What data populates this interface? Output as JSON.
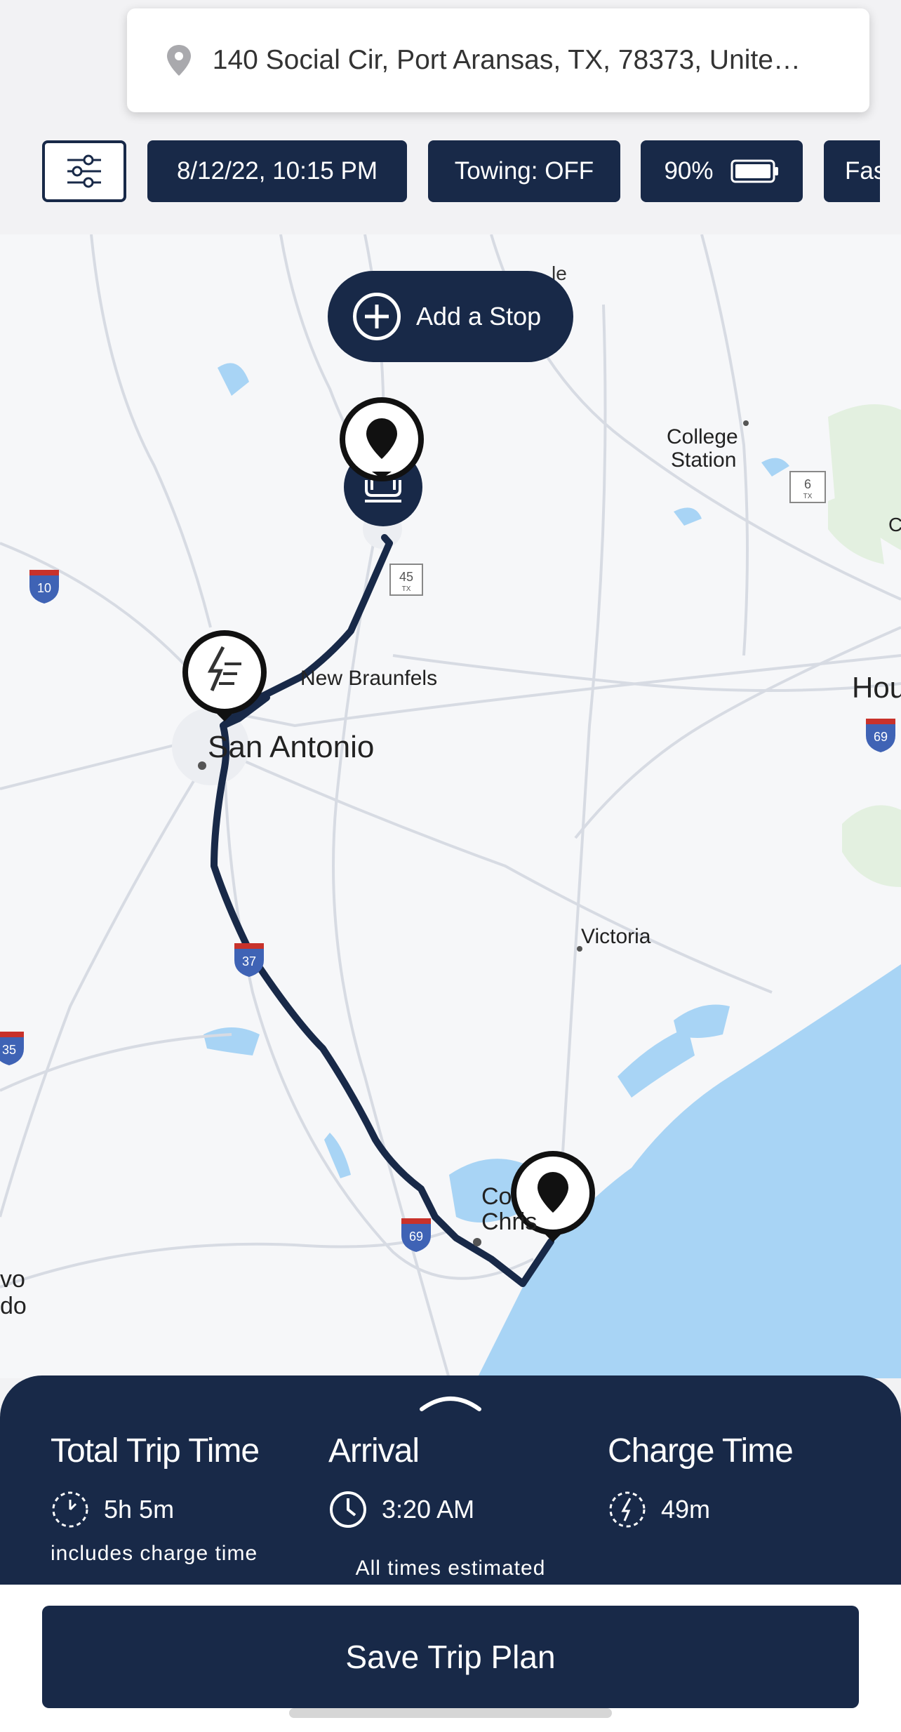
{
  "search": {
    "address": "140 Social Cir, Port Aransas, TX, 78373, Unite…",
    "icon": "location-pin-icon"
  },
  "chips": {
    "filter_icon": "sliders-icon",
    "datetime": "8/12/22, 10:15 PM",
    "towing": "Towing: OFF",
    "battery": "90%",
    "battery_icon": "battery-icon",
    "partial": "Fas"
  },
  "map": {
    "add_stop": "Add a Stop",
    "labels": {
      "college_station_1": "College",
      "college_station_2": "Station",
      "new_braunfels": "New Braunfels",
      "san_antonio": "San Antonio",
      "victoria": "Victoria",
      "houston_partial": "Hou",
      "corpus_1": "Co",
      "corpus_2": "Chris",
      "laredo_1": "vo",
      "laredo_2": "do",
      "edge_c": "C",
      "top_partial": "le"
    },
    "shields": {
      "i10": "10",
      "i37": "37",
      "i35": "35",
      "i69_a": "69",
      "i69_b": "69",
      "tx45": "45",
      "tx6": "6",
      "tx": "TX"
    },
    "colors": {
      "route": "#182948",
      "water": "#a8d4f5",
      "roads": "#d7dbe3"
    }
  },
  "summary": {
    "total_label": "Total Trip Time",
    "total_value": "5h 5m",
    "total_note": "includes charge time",
    "arrival_label": "Arrival",
    "arrival_value": "3:20 AM",
    "charge_label": "Charge Time",
    "charge_value": "49m",
    "estimated": "All times estimated"
  },
  "save_button": "Save Trip Plan"
}
